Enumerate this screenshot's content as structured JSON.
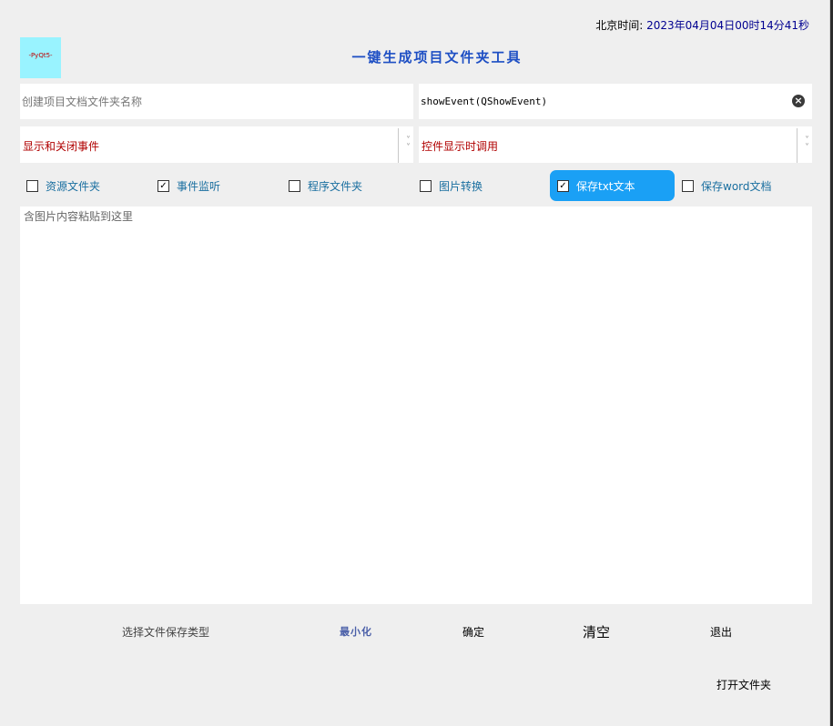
{
  "header": {
    "clock_label": "北京时间:",
    "clock_value": "2023年04月04日00时14分41秒",
    "logo_text": "-PyQt5-",
    "title": "一键生成项目文件夹工具"
  },
  "inputs": {
    "folder_name_placeholder": "创建项目文档文件夹名称",
    "event_value": "showEvent(QShowEvent)"
  },
  "combos": {
    "left": "显示和关闭事件",
    "right": "控件显示时调用"
  },
  "checkboxes": [
    {
      "label": "资源文件夹",
      "checked": false
    },
    {
      "label": "事件监听",
      "checked": true
    },
    {
      "label": "程序文件夹",
      "checked": false
    },
    {
      "label": "图片转换",
      "checked": false
    },
    {
      "label": "保存txt文本",
      "checked": true
    },
    {
      "label": "保存word文档",
      "checked": false
    }
  ],
  "paste_area": {
    "placeholder": "含图片内容粘贴到这里"
  },
  "footer": {
    "type_label": "选择文件保存类型",
    "minimize": "最小化",
    "confirm": "确定",
    "clear": "清空",
    "exit": "退出",
    "open_folder": "打开文件夹"
  },
  "colors": {
    "accent": "#1aa0f5",
    "title": "#1e4fc4",
    "combo_text": "#b00000",
    "logo_bg": "#99f3ff"
  }
}
